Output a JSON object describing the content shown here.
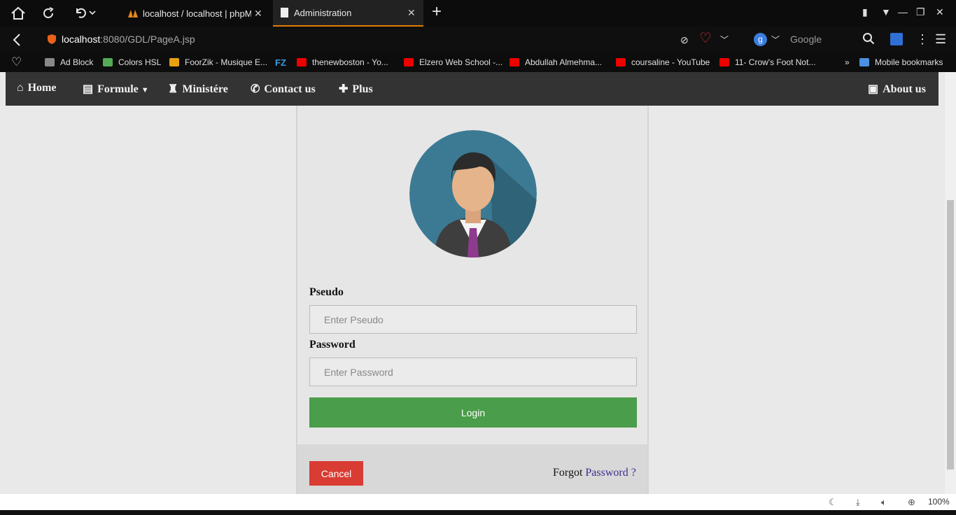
{
  "browser": {
    "tabs": [
      {
        "title": "localhost / localhost | phpMy",
        "active": false
      },
      {
        "title": "Administration",
        "active": true
      }
    ],
    "url": {
      "host": "localhost",
      "rest": ":8080/GDL/PageA.jsp"
    },
    "search_placeholder": "Google",
    "bookmarks": [
      "Ad Block",
      "Colors HSL",
      "FoorZik - Musique E...",
      "thenewboston - Yo...",
      "Elzero Web School -...",
      "Abdullah Almehma...",
      "coursaline - YouTube",
      "11- Crow's Foot Not...",
      "Mobile bookmarks"
    ],
    "zoom": "100%"
  },
  "nav": {
    "home": "Home",
    "formule": "Formule",
    "ministere": "Ministére",
    "contact": "Contact us",
    "plus": "Plus",
    "about": "About us"
  },
  "form": {
    "pseudo_label": "Pseudo",
    "pseudo_placeholder": "Enter Pseudo",
    "password_label": "Password",
    "password_placeholder": "Enter Password",
    "login_button": "Login",
    "cancel_button": "Cancel",
    "forgot_text": "Forgot",
    "forgot_link": "Password ?"
  },
  "colors": {
    "navbar": "#333333",
    "login": "#4a9d4a",
    "cancel": "#d93c33",
    "tab_accent": "#e07b00"
  }
}
